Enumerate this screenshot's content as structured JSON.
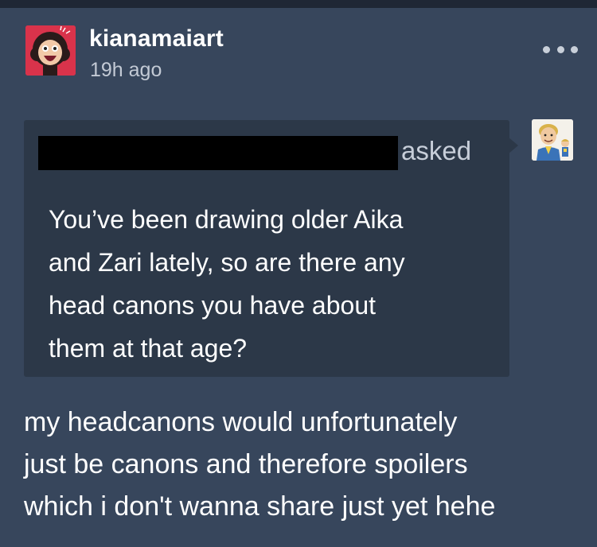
{
  "post": {
    "author": {
      "username": "kianamaiart",
      "avatar_icon": "cartoon-girl-avatar-icon",
      "avatar_bg": "#d9334b"
    },
    "timestamp": "19h ago",
    "more_icon": "ellipsis-icon"
  },
  "ask": {
    "asked_label": "asked",
    "asker_avatar_icon": "cartoon-character-avatar-icon",
    "question_lines": [
      "You’ve been drawing older Aika",
      "and Zari lately, so are there any",
      "head canons you have about",
      "them at that age?"
    ]
  },
  "answer": {
    "lines": [
      "my headcanons would unfortunately",
      "just be canons and therefore spoilers",
      "which i don't wanna share just yet hehe"
    ]
  },
  "colors": {
    "background": "#37465c",
    "ask_box": "#2c3848",
    "text": "#ffffff",
    "muted_text": "#c3cad5"
  }
}
